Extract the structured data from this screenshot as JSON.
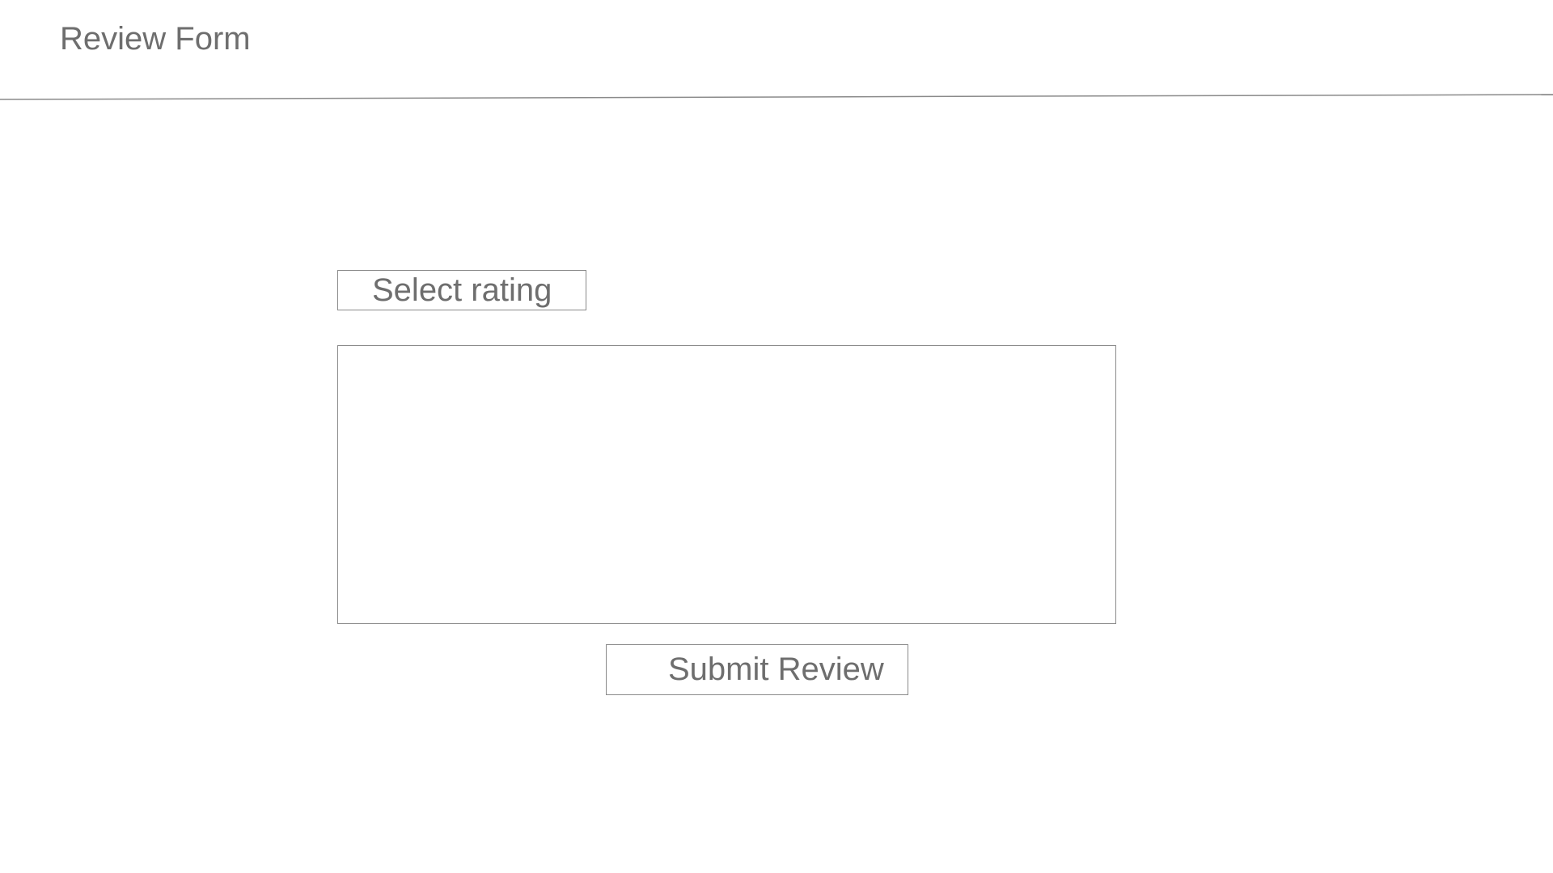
{
  "header": {
    "title": "Review Form"
  },
  "form": {
    "rating_select": {
      "selected": "Select rating"
    },
    "review_text": {
      "value": "",
      "placeholder": ""
    },
    "submit_label": "Submit Review"
  },
  "colors": {
    "text": "#6e6e6e",
    "border": "#8a8a8a",
    "background": "#ffffff"
  }
}
